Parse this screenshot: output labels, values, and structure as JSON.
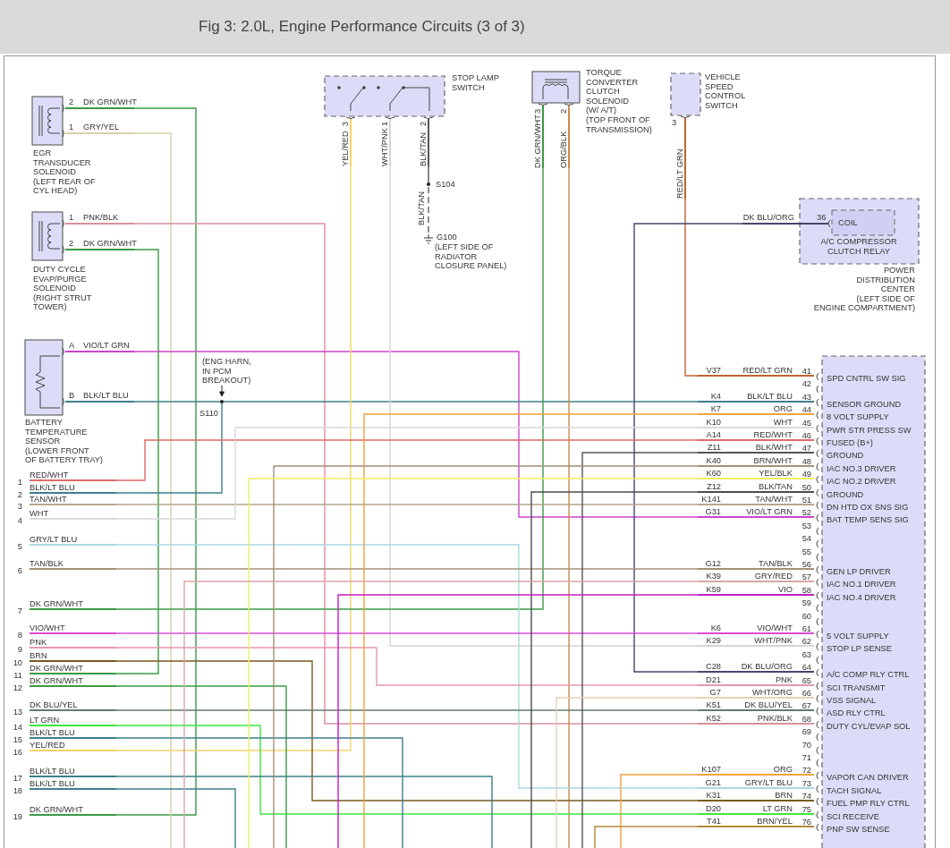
{
  "title": "Fig 3: 2.0L, Engine Performance Circuits (3 of 3)",
  "components": [
    {
      "kind": "solenoid",
      "label": [
        "EGR",
        "TRANSDUCER",
        "SOLENOID",
        "(LEFT REAR OF",
        "CYL HEAD)"
      ],
      "pins": [
        {
          "pin": "2",
          "wire": "DK GRN/WHT",
          "color": "#3b9a45"
        },
        {
          "pin": "1",
          "wire": "GRY/YEL",
          "color": "#d8d0a8"
        }
      ]
    },
    {
      "kind": "solenoid",
      "label": [
        "DUTY CYCLE",
        "EVAP/PURGE",
        "SOLENOID",
        "(RIGHT STRUT",
        "TOWER)"
      ],
      "pins": [
        {
          "pin": "1",
          "wire": "PNK/BLK",
          "color": "#d9909c"
        },
        {
          "pin": "2",
          "wire": "DK GRN/WHT",
          "color": "#3b9a45"
        }
      ]
    },
    {
      "kind": "sensor",
      "label": [
        "BATTERY",
        "TEMPERATURE",
        "SENSOR",
        "(LOWER FRONT",
        "OF BATTERY TRAY)"
      ],
      "pins": [
        {
          "pin": "A",
          "wire": "VIO/LT GRN",
          "color": "#cc44cc"
        },
        {
          "pin": "B",
          "wire": "BLK/LT BLU",
          "color": "#3d7f8c"
        }
      ]
    },
    {
      "kind": "switch",
      "label": [
        "STOP LAMP",
        "SWITCH"
      ],
      "pins": [
        {
          "pin": "3",
          "wire": "YEL/RED",
          "color": "#f2d36b"
        },
        {
          "pin": "1",
          "wire": "WHT/PNK",
          "color": "#dcd2d2"
        },
        {
          "pin": "2",
          "wire": "BLK/TAN",
          "color": "#555555"
        }
      ]
    },
    {
      "kind": "solenoid_top",
      "label": [
        "TORQUE",
        "CONVERTER",
        "CLUTCH",
        "SOLENOID",
        "(W/ A/T)",
        "(TOP FRONT OF",
        "TRANSMISSION)"
      ],
      "pins": [
        {
          "pin": "3",
          "wire": "DK GRN/WHT",
          "color": "#3b9a45"
        },
        {
          "pin": "2",
          "wire": "ORG/BLK",
          "color": "#d08a40"
        }
      ]
    },
    {
      "kind": "module",
      "label": [
        "VEHICLE",
        "SPEED",
        "CONTROL",
        "SWITCH"
      ],
      "pins": [
        {
          "pin": "3",
          "wire": "RED/LT GRN",
          "color": "#c4622f"
        }
      ]
    },
    {
      "kind": "relay",
      "coil": "COIL",
      "label": [
        "A/C COMPRESSOR",
        "CLUTCH RELAY"
      ],
      "pins": [
        {
          "pin": "36",
          "wire": "DK BLU/ORG",
          "color": "#43476b"
        }
      ]
    }
  ],
  "power_center": [
    "POWER",
    "DISTRIBUTION",
    "CENTER",
    "(LEFT SIDE OF",
    "ENGINE COMPARTMENT)"
  ],
  "splices": [
    {
      "id": "S110",
      "note": [
        "(ENG HARN,",
        "IN PCM",
        "BREAKOUT)"
      ]
    },
    {
      "id": "S104"
    }
  ],
  "ground": {
    "id": "G100",
    "wire": "BLK/TAN",
    "note": [
      "(LEFT SIDE OF",
      "RADIATOR",
      "CLOSURE PANEL)"
    ]
  },
  "connector_rows": [
    {
      "pin": "1",
      "wire": "RED/WHT",
      "color": "#e06a6a"
    },
    {
      "pin": "2",
      "wire": "BLK/LT BLU",
      "color": "#3d7f8c"
    },
    {
      "pin": "3",
      "wire": "TAN/WHT",
      "color": "#b5a68a"
    },
    {
      "pin": "4",
      "wire": "WHT",
      "color": "#d9d9d9"
    },
    {
      "pin": "5",
      "wire": "GRY/LT BLU",
      "color": "#a9d9e3"
    },
    {
      "pin": "6",
      "wire": "TAN/BLK",
      "color": "#a39178"
    },
    {
      "pin": "7",
      "wire": "DK GRN/WHT",
      "color": "#3b9a45"
    },
    {
      "pin": "8",
      "wire": "VIO/WHT",
      "color": "#d94bd9"
    },
    {
      "pin": "9",
      "wire": "PNK",
      "color": "#e897ad"
    },
    {
      "pin": "10",
      "wire": "BRN",
      "color": "#7a5a1e"
    },
    {
      "pin": "11",
      "wire": "DK GRN/WHT",
      "color": "#3b9a45"
    },
    {
      "pin": "12",
      "wire": "DK GRN/WHT",
      "color": "#3b9a45"
    },
    {
      "pin": "13",
      "wire": "DK BLU/YEL",
      "color": "#667a6a"
    },
    {
      "pin": "14",
      "wire": "LT GRN",
      "color": "#3ee63e"
    },
    {
      "pin": "15",
      "wire": "BLK/LT BLU",
      "color": "#3d7f8c"
    },
    {
      "pin": "16",
      "wire": "YEL/RED",
      "color": "#f2d36b"
    },
    {
      "pin": "17",
      "wire": "BLK/LT BLU",
      "color": "#3d7f8c"
    },
    {
      "pin": "18",
      "wire": "BLK/LT BLU",
      "color": "#3d7f8c"
    },
    {
      "pin": "19",
      "wire": "DK GRN/WHT",
      "color": "#3b9a45"
    }
  ],
  "pcm_pins": [
    {
      "pin": "41",
      "circuit": "V37",
      "wire": "RED/LT GRN",
      "color": "#c4622f",
      "function": "SPD CNTRL SW SIG"
    },
    {
      "pin": "42"
    },
    {
      "pin": "43",
      "circuit": "K4",
      "wire": "BLK/LT BLU",
      "color": "#3d7f8c",
      "function": "SENSOR GROUND"
    },
    {
      "pin": "44",
      "circuit": "K7",
      "wire": "ORG",
      "color": "#f0a23c",
      "function": "8 VOLT SUPPLY"
    },
    {
      "pin": "45",
      "circuit": "K10",
      "wire": "WHT",
      "color": "#d9d9d9",
      "function": "PWR STR PRESS SW"
    },
    {
      "pin": "46",
      "circuit": "A14",
      "wire": "RED/WHT",
      "color": "#e06a6a",
      "function": "FUSED (B+)"
    },
    {
      "pin": "47",
      "circuit": "Z11",
      "wire": "BLK/WHT",
      "color": "#555555",
      "function": "GROUND"
    },
    {
      "pin": "48",
      "circuit": "K40",
      "wire": "BRN/WHT",
      "color": "#a39178",
      "function": "IAC NO.3 DRIVER"
    },
    {
      "pin": "49",
      "circuit": "K60",
      "wire": "YEL/BLK",
      "color": "#eeee66",
      "function": "IAC NO.2 DRIVER"
    },
    {
      "pin": "50",
      "circuit": "Z12",
      "wire": "BLK/TAN",
      "color": "#4d4d4d",
      "function": "GROUND"
    },
    {
      "pin": "51",
      "circuit": "K141",
      "wire": "TAN/WHT",
      "color": "#b5a68a",
      "function": "DN HTD OX SNS SIG"
    },
    {
      "pin": "52",
      "circuit": "G31",
      "wire": "VIO/LT GRN",
      "color": "#cc44cc",
      "function": "BAT TEMP SENS SIG"
    },
    {
      "pin": "53"
    },
    {
      "pin": "54"
    },
    {
      "pin": "55"
    },
    {
      "pin": "56",
      "circuit": "G12",
      "wire": "TAN/BLK",
      "color": "#a39178",
      "function": "GEN LP DRIVER"
    },
    {
      "pin": "57",
      "circuit": "K39",
      "wire": "GRY/RED",
      "color": "#d6a6a6",
      "function": "IAC NO.1 DRIVER"
    },
    {
      "pin": "58",
      "circuit": "K59",
      "wire": "VIO",
      "color": "#c21fc2",
      "function": "IAC NO.4 DRIVER"
    },
    {
      "pin": "59"
    },
    {
      "pin": "60"
    },
    {
      "pin": "61",
      "circuit": "K6",
      "wire": "VIO/WHT",
      "color": "#d94bd9",
      "function": "5 VOLT SUPPLY"
    },
    {
      "pin": "62",
      "circuit": "K29",
      "wire": "WHT/PNK",
      "color": "#dcd2d2",
      "function": "STOP LP SENSE"
    },
    {
      "pin": "63"
    },
    {
      "pin": "64",
      "circuit": "C28",
      "wire": "DK BLU/ORG",
      "color": "#43476b",
      "function": "A/C COMP RLY CTRL"
    },
    {
      "pin": "65",
      "circuit": "D21",
      "wire": "PNK",
      "color": "#e897ad",
      "function": "SCI TRANSMIT"
    },
    {
      "pin": "66",
      "circuit": "G7",
      "wire": "WHT/ORG",
      "color": "#e3d3b5",
      "function": "VSS SIGNAL"
    },
    {
      "pin": "67",
      "circuit": "K51",
      "wire": "DK BLU/YEL",
      "color": "#667a6a",
      "function": "ASD RLY CTRL"
    },
    {
      "pin": "68",
      "circuit": "K52",
      "wire": "PNK/BLK",
      "color": "#d9909c",
      "function": "DUTY CYL/EVAP SOL"
    },
    {
      "pin": "69"
    },
    {
      "pin": "70"
    },
    {
      "pin": "71"
    },
    {
      "pin": "72",
      "circuit": "K107",
      "wire": "ORG",
      "color": "#f0a23c",
      "function": "VAPOR CAN DRIVER"
    },
    {
      "pin": "73",
      "circuit": "G21",
      "wire": "GRY/LT BLU",
      "color": "#a9d9e3",
      "function": "TACH SIGNAL"
    },
    {
      "pin": "74",
      "circuit": "K31",
      "wire": "BRN",
      "color": "#7a5a1e",
      "function": "FUEL PMP RLY CTRL"
    },
    {
      "pin": "75",
      "circuit": "D20",
      "wire": "LT GRN",
      "color": "#3ee63e",
      "function": "SCI RECEIVE"
    },
    {
      "pin": "76",
      "circuit": "T41",
      "wire": "BRN/YEL",
      "color": "#b08a3a",
      "function": "PNP SW SENSE"
    }
  ]
}
